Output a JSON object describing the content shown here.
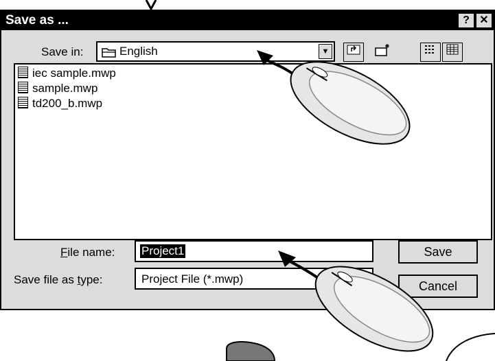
{
  "window": {
    "title": "Save as ...",
    "help_label": "?",
    "close_label": "✕"
  },
  "toolbar": {
    "save_in_label": "Save in:",
    "folder": "English",
    "tools": [
      "up-folder-icon",
      "new-folder-icon",
      "list-view-icon",
      "details-view-icon"
    ]
  },
  "files": [
    "iec sample.mwp",
    "sample.mwp",
    "td200_b.mwp"
  ],
  "form": {
    "file_name_label_first": "F",
    "file_name_label_rest": "ile name:",
    "file_name_value": "Project1",
    "type_label_pre": "Save file as ",
    "type_label_u": "t",
    "type_label_post": "ype:",
    "type_value": "Project File (*.mwp)"
  },
  "buttons": {
    "save": "Save",
    "cancel": "Cancel"
  }
}
